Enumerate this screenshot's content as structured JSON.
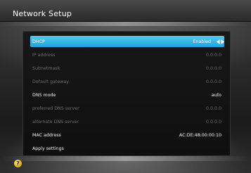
{
  "window": {
    "title": "Network Setup"
  },
  "settings": [
    {
      "label": "DHCP",
      "value": "Enabled",
      "state": "selected"
    },
    {
      "label": "IP address",
      "value": "0.0.0.0",
      "state": "disabled"
    },
    {
      "label": "Subnetmask",
      "value": "0.0.0.0",
      "state": "disabled"
    },
    {
      "label": "Default gateway",
      "value": "0.0.0.0",
      "state": "disabled"
    },
    {
      "label": "DNS mode",
      "value": "auto",
      "state": "normal"
    },
    {
      "label": "preferred DNS server",
      "value": "0.0.0.0",
      "state": "disabled"
    },
    {
      "label": "alternate DNS server",
      "value": "0.0.0.0",
      "state": "disabled"
    },
    {
      "label": "MAC address",
      "value": "AC:DE:48:00:00:10",
      "state": "normal"
    },
    {
      "label": "Apply settings",
      "value": "",
      "state": "normal"
    }
  ],
  "help": {
    "glyph": "?",
    "icon": "help-icon"
  }
}
